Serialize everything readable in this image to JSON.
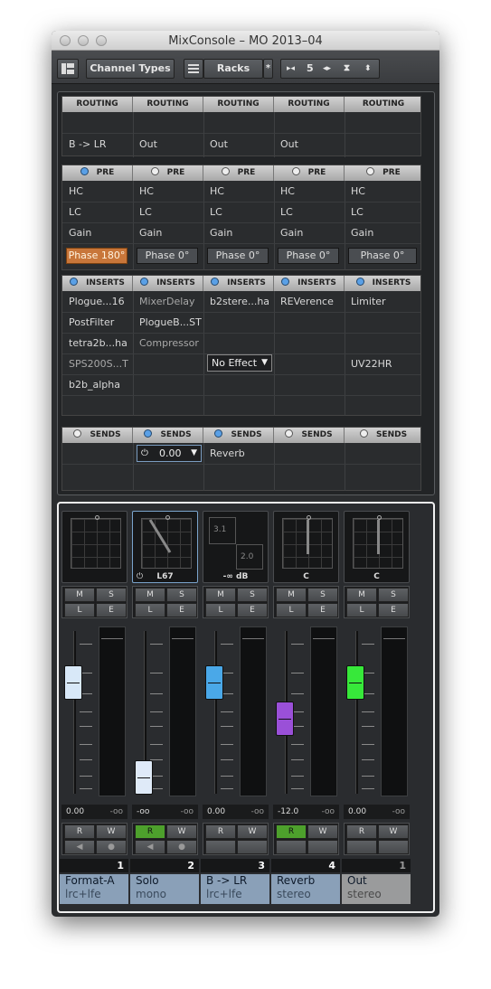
{
  "window": {
    "title": "MixConsole – MO 2013–04"
  },
  "toolbar": {
    "channel_types": "Channel Types",
    "racks": "Racks",
    "star": "*",
    "zoom_value": "5"
  },
  "routing": {
    "header": "ROUTING",
    "values": [
      "B -> LR",
      "Out",
      "Out",
      "Out",
      ""
    ]
  },
  "pre": {
    "header": "PRE",
    "rows": [
      "HC",
      "LC",
      "Gain"
    ],
    "phase": [
      "Phase 180°",
      "Phase 0°",
      "Phase 0°",
      "Phase 0°",
      "Phase 0°"
    ],
    "phase_active": [
      true,
      false,
      false,
      false,
      false
    ],
    "power_on": [
      true,
      false,
      false,
      false,
      false
    ]
  },
  "inserts": {
    "header": "INSERTS",
    "power_on": [
      true,
      true,
      true,
      true,
      true
    ],
    "columns": [
      [
        "Plogue...16",
        "PostFilter",
        "tetra2b...ha",
        "SPS200S...T",
        "b2b_alpha"
      ],
      [
        "MixerDelay",
        "PlogueB...ST",
        "Compressor",
        "",
        ""
      ],
      [
        "b2stere...ha",
        "",
        "",
        "",
        ""
      ],
      [
        "REVerence",
        "",
        "",
        "",
        ""
      ],
      [
        "Limiter",
        "",
        "",
        "UV22HR",
        ""
      ]
    ],
    "no_effect": "No Effect"
  },
  "sends": {
    "header": "SENDS",
    "power_on": [
      false,
      true,
      true,
      false,
      false
    ],
    "level": "0.00",
    "dest": "Reverb"
  },
  "strips": [
    {
      "number": "1",
      "name": "Format-A",
      "config": "lrc+lfe",
      "panner": "",
      "volume": "0.00",
      "peak": "-oo",
      "read_on": false,
      "fader_pos": 0.27,
      "fader_color": "#d8e8f8"
    },
    {
      "number": "2",
      "name": "Solo",
      "config": "mono",
      "panner": "L67",
      "volume": "-oo",
      "peak": "-oo",
      "read_on": true,
      "fader_pos": 0.98,
      "fader_color": "#dfeaf8"
    },
    {
      "number": "3",
      "name": "B -> LR",
      "config": "lrc+lfe",
      "panner": "-∞ dB",
      "volume": "0.00",
      "peak": "-oo",
      "read_on": false,
      "fader_pos": 0.27,
      "fader_color": "#4aa8e8",
      "surround": [
        "3.1",
        "2.0"
      ]
    },
    {
      "number": "4",
      "name": "Reverb",
      "config": "stereo",
      "panner": "C",
      "volume": "-12.0",
      "peak": "-oo",
      "read_on": true,
      "fader_pos": 0.54,
      "fader_color": "#9a50d8"
    },
    {
      "number": "1",
      "name": "Out",
      "config": "stereo",
      "panner": "C",
      "volume": "0.00",
      "peak": "-oo",
      "read_on": false,
      "fader_pos": 0.27,
      "fader_color": "#37e83a"
    }
  ],
  "buttons": {
    "m": "M",
    "s": "S",
    "l": "L",
    "e": "E",
    "r": "R",
    "w": "W"
  }
}
